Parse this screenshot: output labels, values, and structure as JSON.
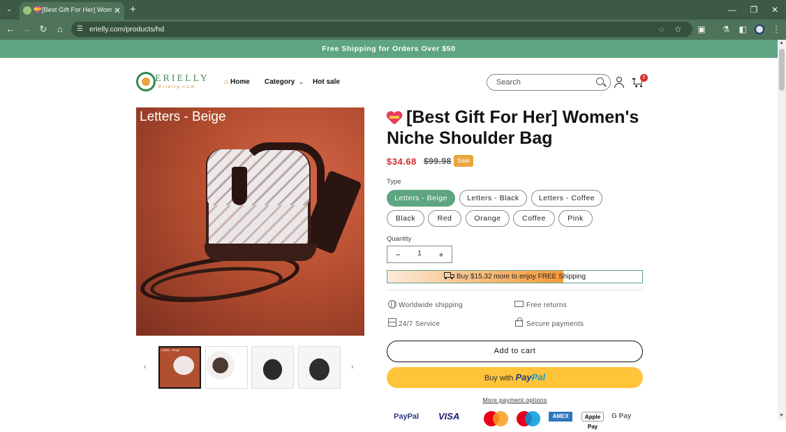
{
  "browser": {
    "tab_title": "💝[Best Gift For Her] Women's",
    "tab_close": "✕",
    "new_tab": "+",
    "url": "erielly.com/products/hd",
    "window_controls": [
      "—",
      "❐",
      "✕"
    ]
  },
  "announcement": "Free Shipping for Orders Over $50",
  "header": {
    "logo_text": "ERIELLY",
    "logo_sub": "Erielly.com",
    "nav": [
      {
        "label": "Home",
        "icon": "home-icon"
      },
      {
        "label": "Category",
        "icon": "chevron-down-icon"
      },
      {
        "label": "Hot sale"
      }
    ],
    "search_placeholder": "Search",
    "cart_count": "0"
  },
  "gallery": {
    "caption": "Letters - Beige",
    "thumb_prev": "‹",
    "thumb_next": "›",
    "thumb_caption": "Letters - Beige"
  },
  "product": {
    "title": "[Best Gift For Her] Women's Niche Shoulder Bag",
    "price": "$34.68",
    "compare_price": "$99.98",
    "sale_badge": "Sale",
    "type_label": "Type",
    "variants": [
      "Letters - Beige",
      "Letters - Black",
      "Letters - Coffee",
      "Black",
      "Red",
      "Orange",
      "Coffee",
      "Pink"
    ],
    "selected_variant": "Letters - Beige",
    "quantity_label": "Quantity",
    "quantity": "1",
    "qty_minus": "−",
    "qty_plus": "+",
    "shipping_bar_text": "Buy $15.32 more to enjoy FREE Shipping",
    "shipping_progress": 0.69,
    "features": [
      {
        "label": "Worldwide shipping",
        "icon": "globe-icon"
      },
      {
        "label": "Free returns",
        "icon": "van-icon"
      },
      {
        "label": "24/7 Service",
        "icon": "box-icon"
      },
      {
        "label": "Secure payments",
        "icon": "lock-icon"
      }
    ],
    "add_to_cart": "Add to cart",
    "buy_with": "Buy with",
    "paypal_word_a": "Pay",
    "paypal_word_b": "Pal",
    "more_payment": "More payment options",
    "payment_logos": [
      "PayPal",
      "VISA",
      "Mastercard",
      "Maestro",
      "AMEX",
      "Apple Pay",
      "G Pay"
    ]
  },
  "colors": {
    "brand_green": "#5fa583",
    "price_red": "#d52b2b",
    "sale_orange": "#e9a53b",
    "paypal_yellow": "#ffc439"
  }
}
